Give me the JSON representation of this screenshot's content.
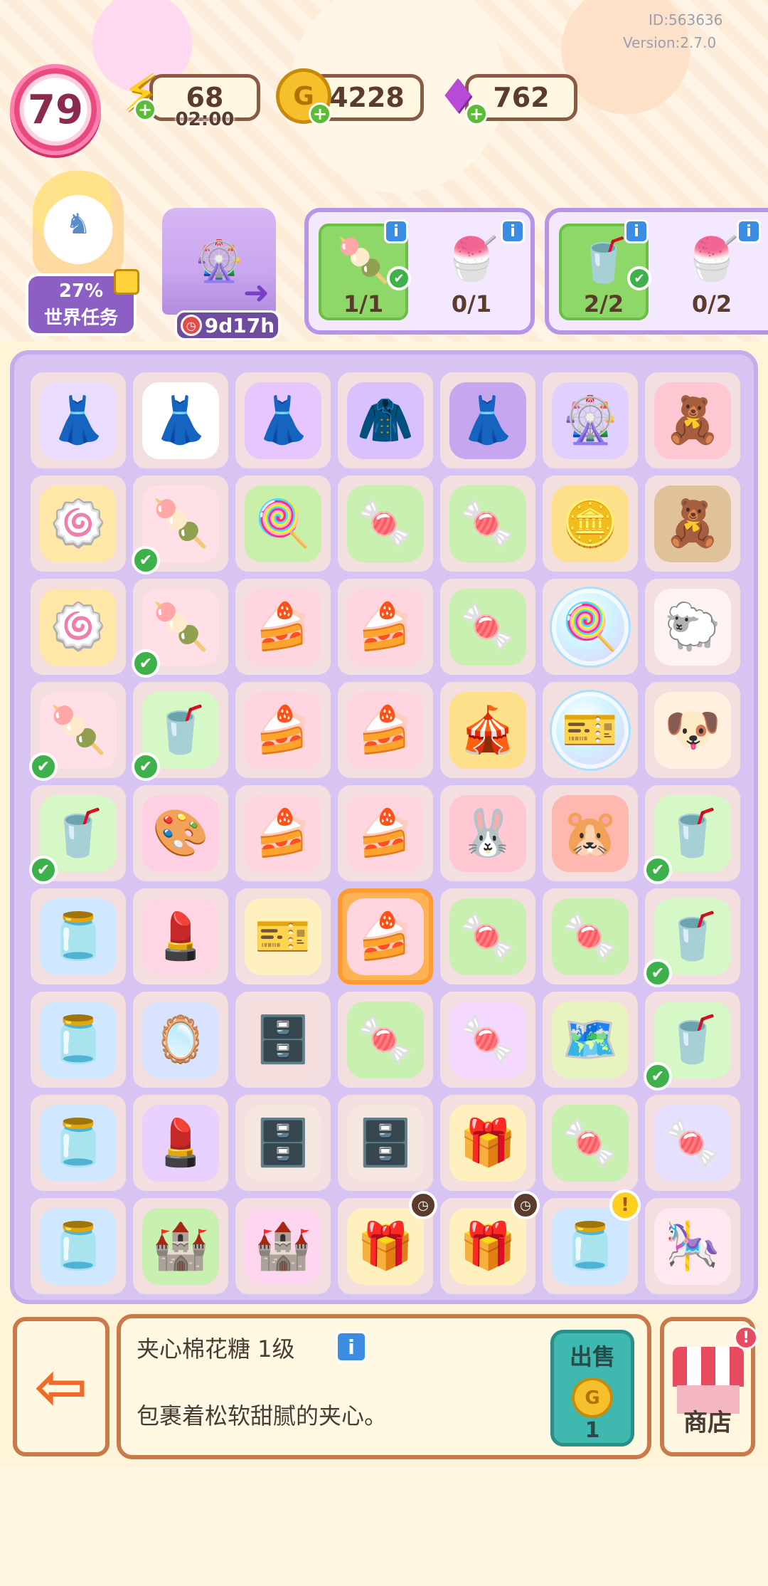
{
  "status": {
    "id": "ID:563636",
    "version": "Version:2.7.0"
  },
  "hud": {
    "level": "79",
    "energy": {
      "value": "68",
      "timer": "02:00",
      "icon": "lightning-icon"
    },
    "coins": {
      "value": "4228",
      "icon": "coin-icon"
    },
    "gems": {
      "value": "762",
      "icon": "gem-icon"
    }
  },
  "world_task": {
    "percent": "27%",
    "label": "世界任务"
  },
  "event": {
    "timer": "9d17h"
  },
  "orders": [
    {
      "items": [
        {
          "name": "marshmallow",
          "glyph": "🍡",
          "count": "1/1",
          "done": true
        },
        {
          "name": "strawberry-cup",
          "glyph": "🍧",
          "count": "0/1",
          "done": false
        }
      ]
    },
    {
      "items": [
        {
          "name": "melon-soda",
          "glyph": "🥤",
          "count": "2/2",
          "done": true
        },
        {
          "name": "strawberry-cup",
          "glyph": "🍧",
          "count": "0/2",
          "done": false
        }
      ]
    }
  ],
  "board": [
    [
      {
        "g": "👗",
        "c": "#e9dcff"
      },
      {
        "g": "👗",
        "c": "#ffffff"
      },
      {
        "g": "👗",
        "c": "#e7c6ff"
      },
      {
        "g": "🧥",
        "c": "#d9c1ff"
      },
      {
        "g": "👗",
        "c": "#c7a6f0"
      },
      {
        "g": "🎡",
        "c": "#e0d0ff"
      },
      {
        "g": "🧸",
        "c": "#ffc8d2"
      }
    ],
    [
      {
        "g": "🍥",
        "c": "#ffe7a8"
      },
      {
        "g": "🍡",
        "c": "#ffe0e6",
        "check": true
      },
      {
        "g": "🍭",
        "c": "#c9f0a8"
      },
      {
        "g": "🍬",
        "c": "#c8f0b0"
      },
      {
        "g": "🍬",
        "c": "#c8f0b0"
      },
      {
        "g": "🪙",
        "c": "#ffe08a"
      },
      {
        "g": "🧸",
        "c": "#e0c29a"
      }
    ],
    [
      {
        "g": "🍥",
        "c": "#ffe7a8"
      },
      {
        "g": "🍡",
        "c": "#ffe0e6",
        "check": true
      },
      {
        "g": "🍰",
        "c": "#ffd6df"
      },
      {
        "g": "🍰",
        "c": "#ffd6df"
      },
      {
        "g": "🍬",
        "c": "#c8f0b0"
      },
      {
        "g": "🍭",
        "c": "",
        "bubble": true
      },
      {
        "g": "🐑",
        "c": "#fff2f2"
      }
    ],
    [
      {
        "g": "🍡",
        "c": "#ffe0e6",
        "check": true
      },
      {
        "g": "🥤",
        "c": "#d6f7c6",
        "check": true
      },
      {
        "g": "🍰",
        "c": "#ffd6df"
      },
      {
        "g": "🍰",
        "c": "#ffd6df"
      },
      {
        "g": "🎪",
        "c": "#ffe08a"
      },
      {
        "g": "🎫",
        "c": "",
        "bubble": true
      },
      {
        "g": "🐶",
        "c": "#fff0e0"
      }
    ],
    [
      {
        "g": "🥤",
        "c": "#d6f7c6",
        "check": true
      },
      {
        "g": "🎨",
        "c": "#ffd0e4"
      },
      {
        "g": "🍰",
        "c": "#ffd6df"
      },
      {
        "g": "🍰",
        "c": "#ffd6df"
      },
      {
        "g": "🐰",
        "c": "#ffc8d2"
      },
      {
        "g": "🐹",
        "c": "#ffb8b0"
      },
      {
        "g": "🥤",
        "c": "#d6f7c6",
        "check": true
      }
    ],
    [
      {
        "g": "🫙",
        "c": "#d0e8ff"
      },
      {
        "g": "💄",
        "c": "#ffd6e4"
      },
      {
        "g": "🎫",
        "c": "#fff0c0"
      },
      {
        "g": "🍰",
        "c": "#ffd6df",
        "selected": true
      },
      {
        "g": "🍬",
        "c": "#c8f0b0"
      },
      {
        "g": "🍬",
        "c": "#c8f0b0"
      },
      {
        "g": "🥤",
        "c": "#d6f7c6",
        "check": true
      }
    ],
    [
      {
        "g": "🫙",
        "c": "#d0e8ff"
      },
      {
        "g": "🪞",
        "c": "#d8e4ff"
      },
      {
        "g": "🗄️",
        "c": "#f5dede"
      },
      {
        "g": "🍬",
        "c": "#c8f0b0"
      },
      {
        "g": "🍬",
        "c": "#f4d8ff"
      },
      {
        "g": "🗺️",
        "c": "#e8f4c0"
      },
      {
        "g": "🥤",
        "c": "#d6f7c6",
        "check": true
      }
    ],
    [
      {
        "g": "🫙",
        "c": "#d0e8ff"
      },
      {
        "g": "💄",
        "c": "#e8d0ff"
      },
      {
        "g": "🗄️",
        "c": "#f5e6e0"
      },
      {
        "g": "🗄️",
        "c": "#f5e6e0"
      },
      {
        "g": "🎁",
        "c": "#fff0c0"
      },
      {
        "g": "🍬",
        "c": "#c8f0b0"
      },
      {
        "g": "🍬",
        "c": "#e8e0ff"
      }
    ],
    [
      {
        "g": "🫙",
        "c": "#d0e8ff"
      },
      {
        "g": "🏰",
        "c": "#c8f0b0"
      },
      {
        "g": "🏰",
        "c": "#ffd6f0"
      },
      {
        "g": "🎁",
        "c": "#fff0c0",
        "clock": true
      },
      {
        "g": "🎁",
        "c": "#fff0c0",
        "clock": true
      },
      {
        "g": "🫙",
        "c": "#d0e8ff",
        "alert": true
      },
      {
        "g": "🎠",
        "c": "#ffe8f0"
      }
    ]
  ],
  "selected_item": {
    "name": "夹心棉花糖 1级",
    "description": "包裹着松软甜腻的夹心。",
    "sell_label": "出售",
    "sell_price": "1"
  },
  "buttons": {
    "exit_icon": "exit-icon",
    "shop_label": "商店"
  }
}
